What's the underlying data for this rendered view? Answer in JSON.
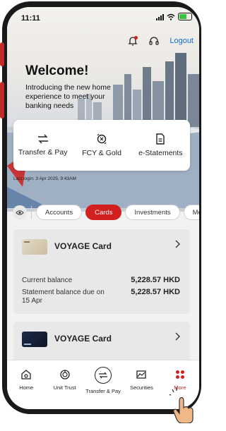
{
  "status_bar": {
    "time": "11:11"
  },
  "header": {
    "logout_label": "Logout"
  },
  "hero": {
    "title": "Welcome!",
    "subtitle": "Introducing the new home experience to meet your banking needs"
  },
  "quick_actions": [
    {
      "label": "Transfer & Pay",
      "icon": "transfer-icon"
    },
    {
      "label": "FCY & Gold",
      "icon": "fcy-gold-icon"
    },
    {
      "label": "e-Statements",
      "icon": "document-icon"
    }
  ],
  "last_login": "Last login: 3 Apr 2025, 9:43AM",
  "tabs": [
    {
      "label": "Accounts",
      "active": false
    },
    {
      "label": "Cards",
      "active": true
    },
    {
      "label": "Investments",
      "active": false
    },
    {
      "label": "Mo",
      "active": false
    }
  ],
  "cards": [
    {
      "name": "VOYAGE Card",
      "current_balance_label": "Current balance",
      "current_balance_value": "5,228.57 HKD",
      "statement_label": "Statement balance due on 15 Apr",
      "statement_value": "5,228.57 HKD"
    },
    {
      "name": "VOYAGE Card"
    }
  ],
  "bottom_nav": [
    {
      "label": "Home",
      "icon": "home-icon"
    },
    {
      "label": "Unit Trust",
      "icon": "unit-trust-icon"
    },
    {
      "label": "Transfer & Pay",
      "icon": "transfer-icon"
    },
    {
      "label": "Securities",
      "icon": "securities-icon"
    },
    {
      "label": "More",
      "icon": "more-icon",
      "active": true
    }
  ],
  "colors": {
    "accent": "#d21f1f",
    "link": "#0b6ed8"
  }
}
